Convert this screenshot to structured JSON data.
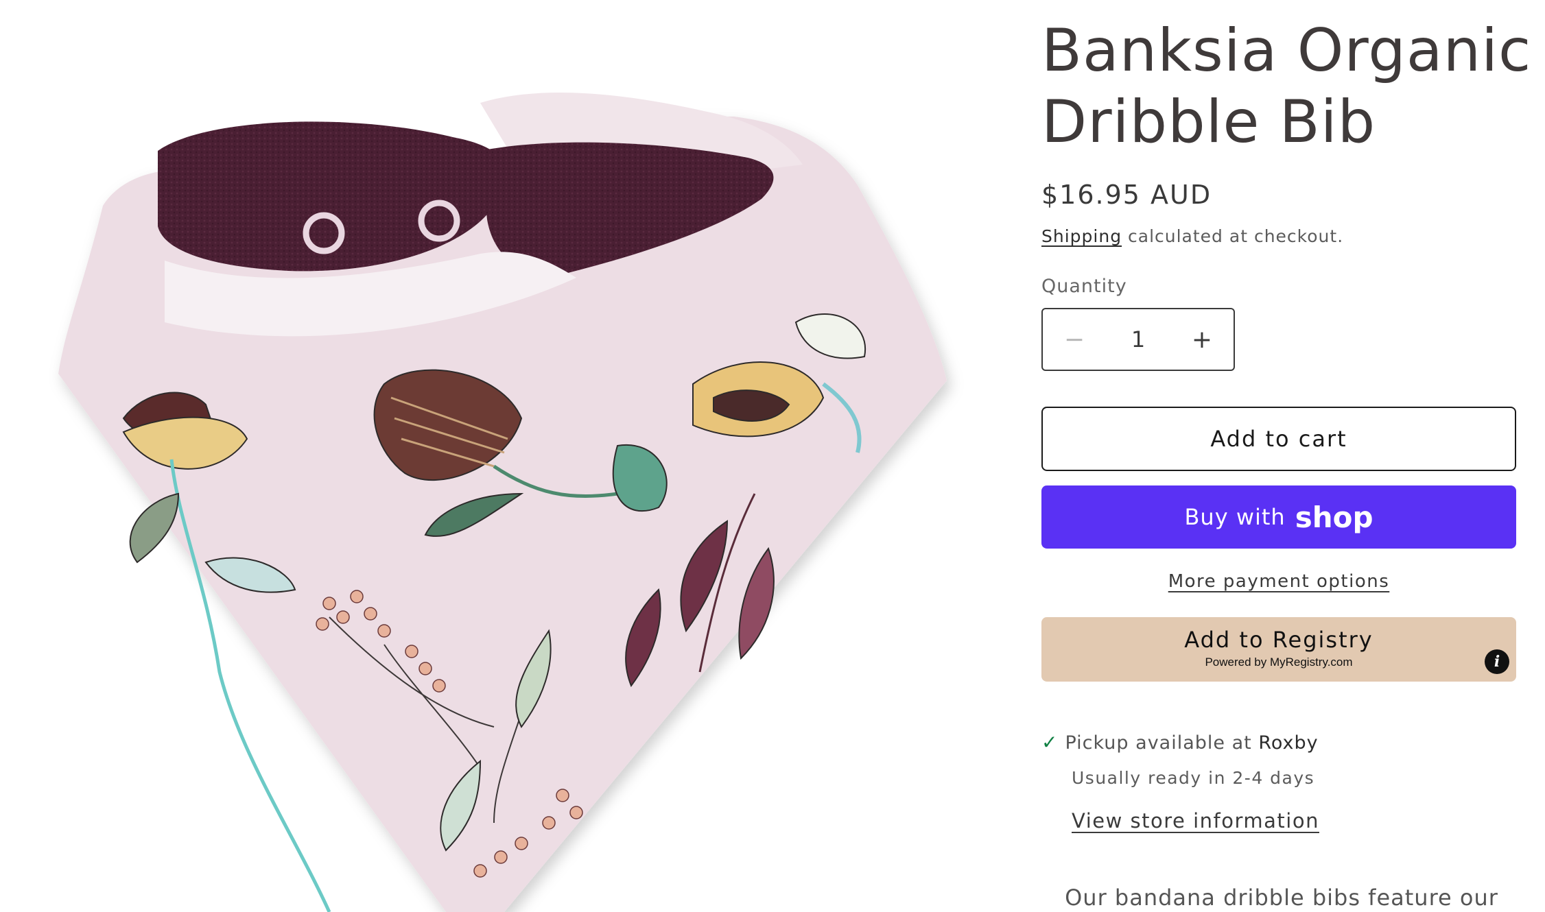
{
  "product": {
    "title_line1": "Banksia Organic",
    "title_line2": "Dribble Bib",
    "price": "$16.95 AUD",
    "shipping_link": "Shipping",
    "shipping_rest": " calculated at checkout.",
    "quantity_label": "Quantity",
    "quantity_value": "1",
    "minus_symbol": "−",
    "plus_symbol": "+",
    "add_to_cart": "Add to cart",
    "buy_with": "Buy with",
    "shop_brand": "shop",
    "more_payment": "More payment options",
    "registry_main": "Add to Registry",
    "registry_sub": "Powered by MyRegistry.com",
    "registry_info": "i",
    "pickup_prefix": "Pickup available at ",
    "pickup_store": "Roxby",
    "ready_text": "Usually ready in 2-4 days",
    "store_info_link": "View store information",
    "description_start": "Our bandana dribble bibs feature our"
  },
  "colors": {
    "shop_button": "#5a31f4",
    "registry_button": "#e2c9b1",
    "check_green": "#108043",
    "bib_fabric": "#eee0e6",
    "bib_lining": "#4b2033"
  },
  "icons": {
    "check": "checkmark-icon",
    "info": "info-icon",
    "minus": "minus-icon",
    "plus": "plus-icon"
  }
}
